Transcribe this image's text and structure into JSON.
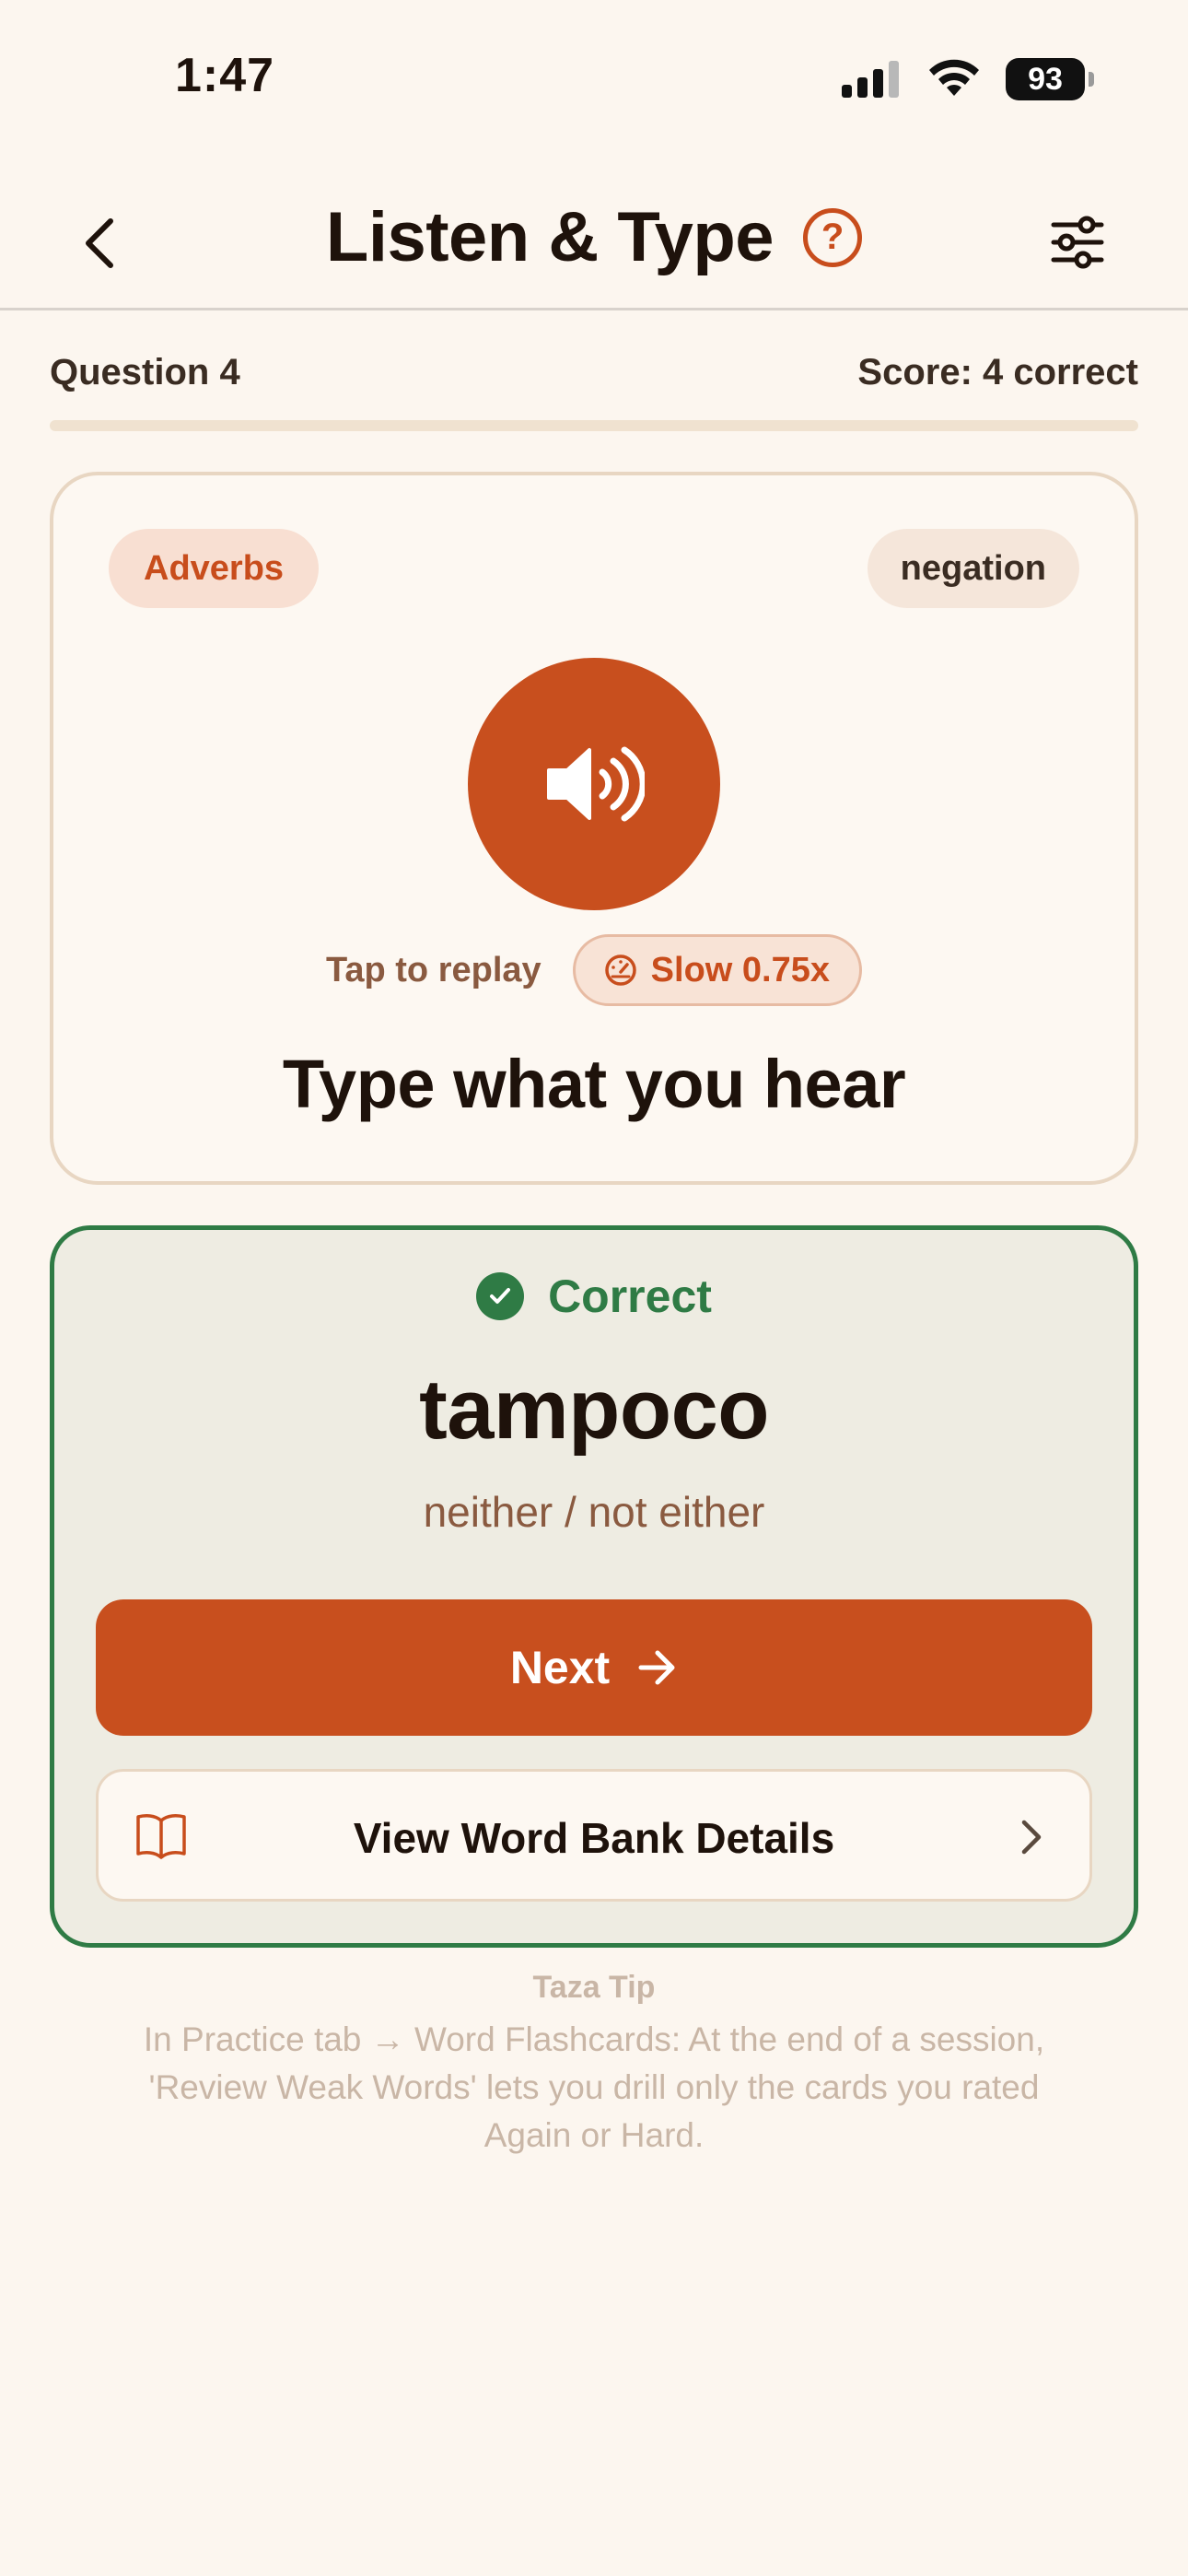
{
  "status_bar": {
    "time": "1:47",
    "battery": "93"
  },
  "header": {
    "title": "Listen & Type",
    "help_glyph": "?"
  },
  "progress": {
    "question_label": "Question 4",
    "score_label": "Score: 4 correct",
    "fraction": 0.0
  },
  "audio_card": {
    "category_tag": "Adverbs",
    "topic_tag": "negation",
    "replay_label": "Tap to replay",
    "speed_label": "Slow 0.75x",
    "prompt": "Type what you hear"
  },
  "result": {
    "status": "Correct",
    "word": "tampoco",
    "translation": "neither / not either",
    "next_label": "Next",
    "word_bank_label": "View Word Bank Details"
  },
  "tip": {
    "title": "Taza Tip",
    "body": "In Practice tab → Word Flashcards: At the end of a session, 'Review Weak Words' lets you drill only the cards you rated Again or Hard."
  },
  "colors": {
    "accent": "#c84f1e",
    "success": "#2f7b45",
    "background": "#fcf6ef"
  },
  "icons": [
    "signal-icon",
    "wifi-icon",
    "battery-icon",
    "back-chevron-icon",
    "help-icon",
    "settings-sliders-icon",
    "speaker-icon",
    "speedometer-icon",
    "check-circle-icon",
    "arrow-right-icon",
    "book-icon",
    "chevron-right-icon"
  ]
}
